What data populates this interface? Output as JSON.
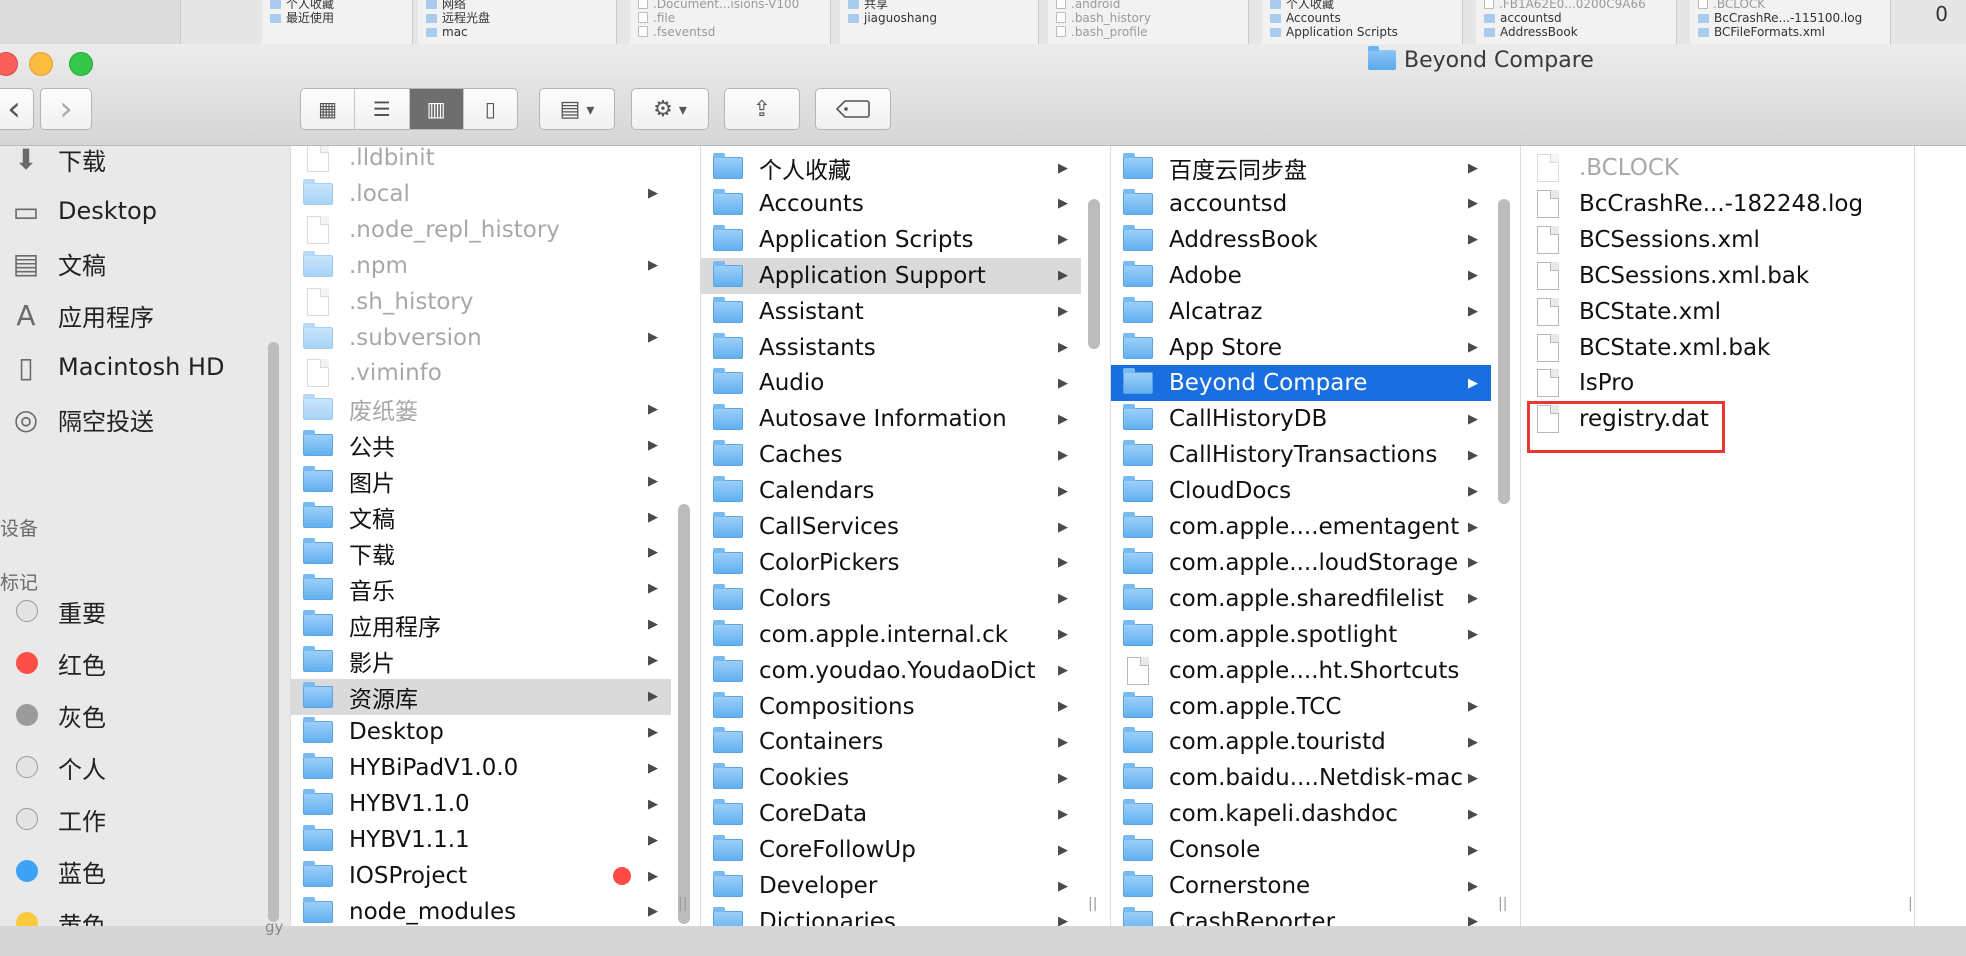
{
  "bg_window": {
    "col_a": [
      {
        "label": "个人收藏",
        "dim": false
      },
      {
        "label": "最近使用",
        "dim": false
      }
    ],
    "col_b": [
      {
        "label": "网络",
        "dim": false
      },
      {
        "label": "远程光盘",
        "dim": false
      },
      {
        "label": "mac",
        "dim": false
      }
    ],
    "col_c": [
      {
        "label": ".Document...isions-V100",
        "dim": true
      },
      {
        "label": ".file",
        "dim": true
      },
      {
        "label": ".fseventsd",
        "dim": true
      }
    ],
    "col_d": [
      {
        "label": "共享",
        "dim": false
      },
      {
        "label": "jiaguoshang",
        "dim": false
      }
    ],
    "col_e": [
      {
        "label": ".android",
        "dim": true
      },
      {
        "label": ".bash_history",
        "dim": true
      },
      {
        "label": ".bash_profile",
        "dim": true
      }
    ],
    "col_f": [
      {
        "label": "个人收藏",
        "dim": false
      },
      {
        "label": "Accounts",
        "dim": false
      },
      {
        "label": "Application Scripts",
        "dim": false
      }
    ],
    "col_g": [
      {
        "label": ".FB1A62E0...0200C9A66",
        "dim": true
      },
      {
        "label": "accountsd",
        "dim": false
      },
      {
        "label": "AddressBook",
        "dim": false
      }
    ],
    "col_h": [
      {
        "label": ".BCLOCK",
        "dim": true
      },
      {
        "label": "BcCrashRe...-115100.log",
        "dim": false
      },
      {
        "label": "BCFileFormats.xml",
        "dim": false
      }
    ],
    "right_number": "0"
  },
  "window": {
    "title": "Beyond Compare",
    "toolbar": {
      "back_icon": "‹",
      "forward_icon": "›",
      "view_icon_grid": "▦",
      "view_icon_list": "☰",
      "view_icon_columns": "▥",
      "view_icon_coverflow": "▯",
      "arrange_icon": "▤",
      "action_icon": "⚙",
      "dropdown_glyph": "▾",
      "share_icon": "⇪",
      "tag_icon": "⌂"
    }
  },
  "sidebar": {
    "items": [
      {
        "label": "下载",
        "icon": "⬇"
      },
      {
        "label": "Desktop",
        "icon": "▭"
      },
      {
        "label": "文稿",
        "icon": "▤"
      },
      {
        "label": "应用程序",
        "icon": "A"
      },
      {
        "label": "Macintosh HD",
        "icon": "▯"
      },
      {
        "label": "隔空投送",
        "icon": "◎"
      }
    ],
    "devices_header": "设备",
    "tags_header": "标记",
    "tags": [
      {
        "label": "重要",
        "color": "#e4e4e4",
        "border": "#9a9a9a"
      },
      {
        "label": "红色",
        "color": "#fc4f4a",
        "border": "#fc4f4a"
      },
      {
        "label": "灰色",
        "color": "#9b9b9b",
        "border": "#9b9b9b"
      },
      {
        "label": "个人",
        "color": "#e4e4e4",
        "border": "#9a9a9a"
      },
      {
        "label": "工作",
        "color": "#e4e4e4",
        "border": "#9a9a9a"
      },
      {
        "label": "蓝色",
        "color": "#3ea3f7",
        "border": "#3ea3f7"
      },
      {
        "label": "黄色",
        "color": "#fbca3c",
        "border": "#fbca3c"
      }
    ]
  },
  "columns": {
    "home": [
      {
        "name": ".lldbinit",
        "kind": "file",
        "dim": true,
        "arrow": false
      },
      {
        "name": ".local",
        "kind": "folder",
        "dim": true,
        "arrow": true
      },
      {
        "name": ".node_repl_history",
        "kind": "file",
        "dim": true,
        "arrow": false
      },
      {
        "name": ".npm",
        "kind": "folder",
        "dim": true,
        "arrow": true
      },
      {
        "name": ".sh_history",
        "kind": "file",
        "dim": true,
        "arrow": false
      },
      {
        "name": ".subversion",
        "kind": "folder",
        "dim": true,
        "arrow": true
      },
      {
        "name": ".viminfo",
        "kind": "file",
        "dim": true,
        "arrow": false
      },
      {
        "name": "废纸篓",
        "kind": "folder",
        "dim": true,
        "arrow": true
      },
      {
        "name": "公共",
        "kind": "folder",
        "dim": false,
        "arrow": true
      },
      {
        "name": "图片",
        "kind": "folder",
        "dim": false,
        "arrow": true
      },
      {
        "name": "文稿",
        "kind": "folder",
        "dim": false,
        "arrow": true
      },
      {
        "name": "下载",
        "kind": "folder",
        "dim": false,
        "arrow": true
      },
      {
        "name": "音乐",
        "kind": "folder",
        "dim": false,
        "arrow": true
      },
      {
        "name": "应用程序",
        "kind": "folder",
        "dim": false,
        "arrow": true
      },
      {
        "name": "影片",
        "kind": "folder",
        "dim": false,
        "arrow": true
      },
      {
        "name": "资源库",
        "kind": "folder",
        "dim": false,
        "arrow": true,
        "selected": "gray"
      },
      {
        "name": "Desktop",
        "kind": "folder",
        "dim": false,
        "arrow": true
      },
      {
        "name": "HYBiPadV1.0.0",
        "kind": "folder",
        "dim": false,
        "arrow": true
      },
      {
        "name": "HYBV1.1.0",
        "kind": "folder",
        "dim": false,
        "arrow": true
      },
      {
        "name": "HYBV1.1.1",
        "kind": "folder",
        "dim": false,
        "arrow": true
      },
      {
        "name": "IOSProject",
        "kind": "folder",
        "dim": false,
        "arrow": true,
        "reddot": true
      },
      {
        "name": "node_modules",
        "kind": "folder",
        "dim": false,
        "arrow": true
      }
    ],
    "library": [
      {
        "name": "个人收藏",
        "kind": "folder",
        "arrow": true
      },
      {
        "name": "Accounts",
        "kind": "folder",
        "arrow": true
      },
      {
        "name": "Application Scripts",
        "kind": "folder",
        "arrow": true
      },
      {
        "name": "Application Support",
        "kind": "folder",
        "arrow": true,
        "selected": "gray"
      },
      {
        "name": "Assistant",
        "kind": "folder",
        "arrow": true
      },
      {
        "name": "Assistants",
        "kind": "folder",
        "arrow": true
      },
      {
        "name": "Audio",
        "kind": "folder",
        "arrow": true
      },
      {
        "name": "Autosave Information",
        "kind": "folder",
        "arrow": true
      },
      {
        "name": "Caches",
        "kind": "folder",
        "arrow": true
      },
      {
        "name": "Calendars",
        "kind": "folder",
        "arrow": true
      },
      {
        "name": "CallServices",
        "kind": "folder",
        "arrow": true
      },
      {
        "name": "ColorPickers",
        "kind": "folder",
        "arrow": true
      },
      {
        "name": "Colors",
        "kind": "folder",
        "arrow": true
      },
      {
        "name": "com.apple.internal.ck",
        "kind": "folder",
        "arrow": true
      },
      {
        "name": "com.youdao.YoudaoDict",
        "kind": "folder",
        "arrow": true
      },
      {
        "name": "Compositions",
        "kind": "folder",
        "arrow": true
      },
      {
        "name": "Containers",
        "kind": "folder",
        "arrow": true
      },
      {
        "name": "Cookies",
        "kind": "folder",
        "arrow": true
      },
      {
        "name": "CoreData",
        "kind": "folder",
        "arrow": true
      },
      {
        "name": "CoreFollowUp",
        "kind": "folder",
        "arrow": true
      },
      {
        "name": "Developer",
        "kind": "folder",
        "arrow": true
      },
      {
        "name": "Dictionaries",
        "kind": "folder",
        "arrow": true
      }
    ],
    "app_support": [
      {
        "name": "百度云同步盘",
        "kind": "folder",
        "arrow": true
      },
      {
        "name": "accountsd",
        "kind": "folder",
        "arrow": true
      },
      {
        "name": "AddressBook",
        "kind": "folder",
        "arrow": true
      },
      {
        "name": "Adobe",
        "kind": "folder",
        "arrow": true
      },
      {
        "name": "Alcatraz",
        "kind": "folder",
        "arrow": true
      },
      {
        "name": "App Store",
        "kind": "folder",
        "arrow": true
      },
      {
        "name": "Beyond Compare",
        "kind": "folder",
        "arrow": true,
        "selected": "blue"
      },
      {
        "name": "CallHistoryDB",
        "kind": "folder",
        "arrow": true
      },
      {
        "name": "CallHistoryTransactions",
        "kind": "folder",
        "arrow": true
      },
      {
        "name": "CloudDocs",
        "kind": "folder",
        "arrow": true
      },
      {
        "name": "com.apple....ementagent",
        "kind": "folder",
        "arrow": true
      },
      {
        "name": "com.apple....loudStorage",
        "kind": "folder",
        "arrow": true
      },
      {
        "name": "com.apple.sharedfilelist",
        "kind": "folder",
        "arrow": true
      },
      {
        "name": "com.apple.spotlight",
        "kind": "folder",
        "arrow": true
      },
      {
        "name": "com.apple....ht.Shortcuts",
        "kind": "file",
        "arrow": false
      },
      {
        "name": "com.apple.TCC",
        "kind": "folder",
        "arrow": true
      },
      {
        "name": "com.apple.touristd",
        "kind": "folder",
        "arrow": true
      },
      {
        "name": "com.baidu....Netdisk-mac",
        "kind": "folder",
        "arrow": true
      },
      {
        "name": "com.kapeli.dashdoc",
        "kind": "folder",
        "arrow": true
      },
      {
        "name": "Console",
        "kind": "folder",
        "arrow": true
      },
      {
        "name": "Cornerstone",
        "kind": "folder",
        "arrow": true
      },
      {
        "name": "CrashReporter",
        "kind": "folder",
        "arrow": true
      }
    ],
    "beyond_compare": [
      {
        "name": ".BCLOCK",
        "kind": "file",
        "dim": true
      },
      {
        "name": "BcCrashRe...-182248.log",
        "kind": "file"
      },
      {
        "name": "BCSessions.xml",
        "kind": "file"
      },
      {
        "name": "BCSessions.xml.bak",
        "kind": "file"
      },
      {
        "name": "BCState.xml",
        "kind": "file"
      },
      {
        "name": "BCState.xml.bak",
        "kind": "file"
      },
      {
        "name": "IsPro",
        "kind": "file"
      },
      {
        "name": "registry.dat",
        "kind": "file",
        "highlighted": true
      }
    ]
  },
  "bottom_fragment": "gy"
}
